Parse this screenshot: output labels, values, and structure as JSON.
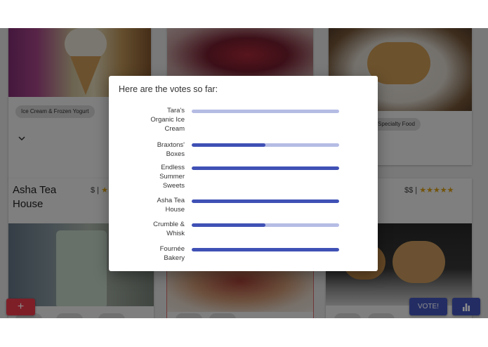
{
  "cards": {
    "ice_cream": {
      "chip": "Ice Cream & Frozen Yogurt"
    },
    "specialty": {
      "chip": "Specialty Food"
    },
    "asha": {
      "title_line1": "Asha Tea",
      "title_line2": "House",
      "price": "$ |"
    },
    "right_card": {
      "price": "$$ |"
    }
  },
  "actions": {
    "add_label": "+",
    "vote_label": "VOTE!"
  },
  "modal": {
    "title": "Here are the votes so far:",
    "votes": [
      {
        "lines": [
          "Tara's",
          "Organic Ice",
          "Cream"
        ],
        "fraction": 0.0
      },
      {
        "lines": [
          "Braxtons'",
          "Boxes"
        ],
        "fraction": 0.5
      },
      {
        "lines": [
          "Endless",
          "Summer",
          "Sweets"
        ],
        "fraction": 1.0
      },
      {
        "lines": [
          "Asha Tea",
          "House"
        ],
        "fraction": 1.0
      },
      {
        "lines": [
          "Crumble &",
          "Whisk"
        ],
        "fraction": 0.5
      },
      {
        "lines": [
          "Fournée",
          "Bakery"
        ],
        "fraction": 1.0
      }
    ]
  },
  "colors": {
    "primary": "#3f51b5",
    "primary_light": "#b5bce4",
    "accent_red": "#e53949",
    "star": "#e6a817"
  },
  "icons": {
    "expand": "chevron-down-icon",
    "stats": "bar-chart-icon",
    "star": "star-icon"
  }
}
